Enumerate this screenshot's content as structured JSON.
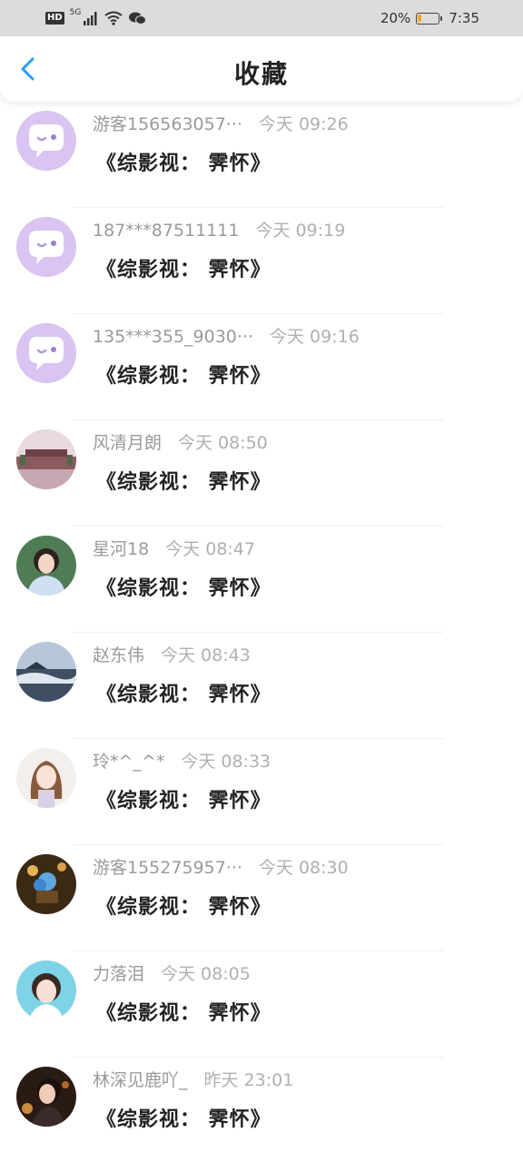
{
  "status_bar": {
    "hd_label": "HD",
    "network": "5G",
    "battery_percent": "20%",
    "battery_level": 0.2,
    "battery_color": "#f5a623",
    "time": "7:35",
    "icons": [
      "signal-icon",
      "wifi-icon",
      "chat-notification-icon",
      "battery-icon"
    ]
  },
  "header": {
    "title": "收藏",
    "back_icon": "chevron-left-icon",
    "accent_color": "#2a9df4"
  },
  "favorites": [
    {
      "name": "游客156563057···",
      "time": "今天 09:26",
      "content": "《综影视： 霁怀》",
      "avatar": "default-chat-avatar"
    },
    {
      "name": "187***87511111",
      "time": "今天 09:19",
      "content": "《综影视： 霁怀》",
      "avatar": "default-chat-avatar"
    },
    {
      "name": "135***355_9030···",
      "time": "今天 09:16",
      "content": "《综影视： 霁怀》",
      "avatar": "default-chat-avatar"
    },
    {
      "name": "风清月朗",
      "time": "今天 08:50",
      "content": "《综影视： 霁怀》",
      "avatar": "palace-photo"
    },
    {
      "name": "星河18",
      "time": "今天 08:47",
      "content": "《综影视： 霁怀》",
      "avatar": "girl-photo"
    },
    {
      "name": "赵东伟",
      "time": "今天 08:43",
      "content": "《综影视： 霁怀》",
      "avatar": "sea-of-clouds-photo"
    },
    {
      "name": "玲*^_^*",
      "time": "今天 08:33",
      "content": "《综影视： 霁怀》",
      "avatar": "anime-girl-illustration"
    },
    {
      "name": "游客155275957···",
      "time": "今天 08:30",
      "content": "《综影视： 霁怀》",
      "avatar": "blue-flowers-photo"
    },
    {
      "name": "力落泪",
      "time": "今天 08:05",
      "content": "《综影视： 霁怀》",
      "avatar": "girl-portrait-photo"
    },
    {
      "name": "林深见鹿吖_",
      "time": "昨天 23:01",
      "content": "《综影视： 霁怀》",
      "avatar": "woman-night-photo"
    }
  ]
}
